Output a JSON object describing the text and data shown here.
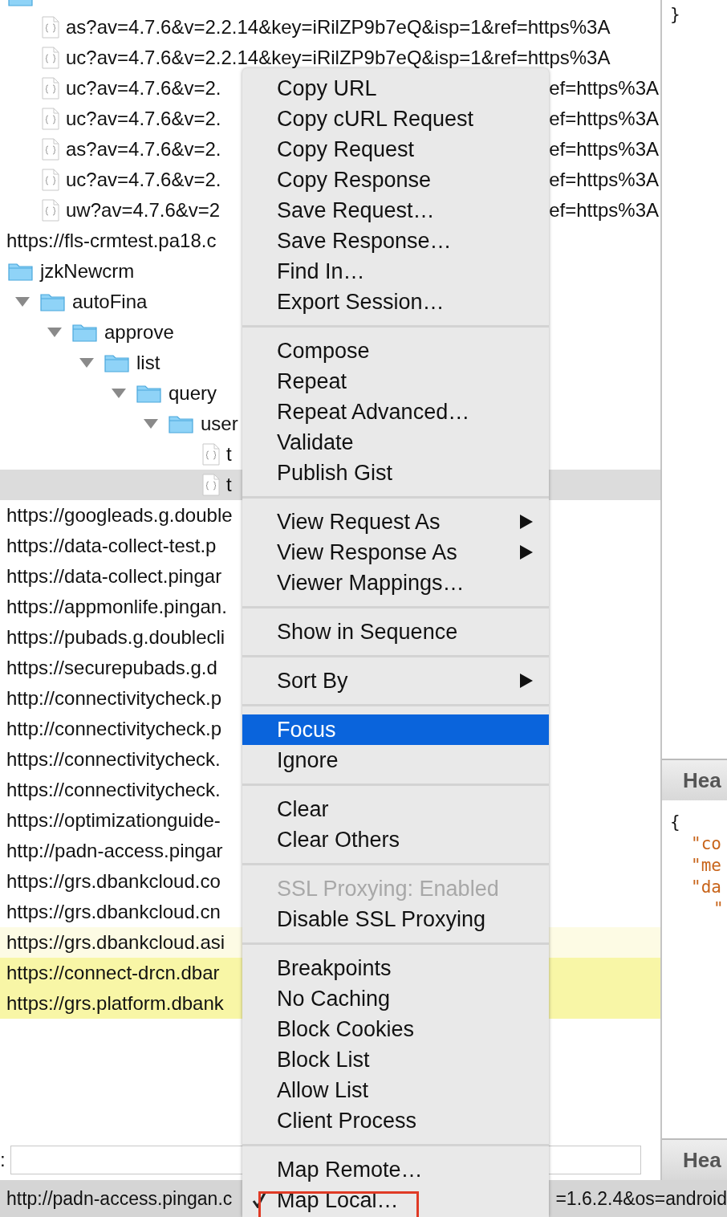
{
  "tree": [
    {
      "kind": "folder",
      "selected": false,
      "children": [
        {
          "kind": "file",
          "label": "as?av=4.7.6&v=2.2.14&key=iRilZP9b7eQ&isp=1&ref=https%3A",
          "selected": false
        },
        {
          "kind": "file",
          "label": "uc?av=4.7.6&v=2.2.14&key=iRilZP9b7eQ&isp=1&ref=https%3A",
          "selected": false
        },
        {
          "kind": "file",
          "label": "uc?av=4.7.6&v=2.",
          "tail": "ef=https%3A",
          "selected": false
        },
        {
          "kind": "file",
          "label": "uc?av=4.7.6&v=2.",
          "tail": "ef=https%3A",
          "selected": false
        },
        {
          "kind": "file",
          "label": "as?av=4.7.6&v=2.",
          "tail": "ef=https%3A",
          "selected": false
        },
        {
          "kind": "file",
          "label": "uc?av=4.7.6&v=2.",
          "tail": "ef=https%3A",
          "selected": false
        },
        {
          "kind": "file",
          "label": "uw?av=4.7.6&v=2",
          "tail": "ef=https%3A",
          "selected": false
        }
      ]
    },
    {
      "kind": "host",
      "label": "https://fls-crmtest.pa18.c",
      "selected": false
    },
    {
      "kind": "folder",
      "label": "jzkNewcrm",
      "selected": false,
      "children": [
        {
          "kind": "folder",
          "label": "autoFina",
          "expanded": true,
          "selected": false,
          "children": [
            {
              "kind": "folder",
              "label": "approve",
              "expanded": true,
              "selected": false,
              "children": [
                {
                  "kind": "folder",
                  "label": "list",
                  "expanded": true,
                  "selected": false,
                  "children": [
                    {
                      "kind": "folder",
                      "label": "query",
                      "expanded": true,
                      "selected": false,
                      "children": [
                        {
                          "kind": "folder",
                          "label": "user",
                          "expanded": true,
                          "selected": false,
                          "children": [
                            {
                              "kind": "file",
                              "label": "t",
                              "selected": false
                            },
                            {
                              "kind": "file",
                              "label": "t",
                              "selected": true
                            }
                          ]
                        }
                      ]
                    }
                  ]
                }
              ]
            }
          ]
        }
      ]
    },
    {
      "kind": "host",
      "label": "https://googleads.g.double",
      "selected": false
    },
    {
      "kind": "host",
      "label": "https://data-collect-test.p",
      "selected": false
    },
    {
      "kind": "host",
      "label": "https://data-collect.pingar",
      "selected": false
    },
    {
      "kind": "host",
      "label": "https://appmonlife.pingan.",
      "selected": false
    },
    {
      "kind": "host",
      "label": "https://pubads.g.doublecli",
      "selected": false
    },
    {
      "kind": "host",
      "label": "https://securepubads.g.d",
      "selected": false
    },
    {
      "kind": "host",
      "label": "http://connectivitycheck.p",
      "selected": false
    },
    {
      "kind": "host",
      "label": "http://connectivitycheck.p",
      "selected": false
    },
    {
      "kind": "host",
      "label": "https://connectivitycheck.",
      "selected": false
    },
    {
      "kind": "host",
      "label": "https://connectivitycheck.",
      "selected": false
    },
    {
      "kind": "host",
      "label": "https://optimizationguide-",
      "selected": false
    },
    {
      "kind": "host",
      "label": "http://padn-access.pingar",
      "selected": false
    },
    {
      "kind": "host",
      "label": "https://grs.dbankcloud.co",
      "selected": false
    },
    {
      "kind": "host",
      "label": "https://grs.dbankcloud.cn",
      "selected": false
    },
    {
      "kind": "host",
      "label": "https://grs.dbankcloud.asi",
      "selected": false,
      "color": "#fdfbe4"
    },
    {
      "kind": "host",
      "label": "https://connect-drcn.dbar",
      "selected": false,
      "color": "#f8f6a6"
    },
    {
      "kind": "host",
      "label": "https://grs.platform.dbank",
      "selected": false,
      "color": "#f8f6a6"
    }
  ],
  "filter": {
    "label": ":"
  },
  "right_pane": {
    "top_text": "}",
    "tabs": [
      "Hea",
      "Hea"
    ],
    "body_open": "{",
    "body_lines": [
      "\"co",
      "\"me",
      "\"da",
      "\""
    ]
  },
  "status_bar": {
    "left": "http://padn-access.pingan.c",
    "right": "=1.6.2.4&os=android"
  },
  "context_menu": {
    "groups": [
      [
        {
          "label": "Copy URL"
        },
        {
          "label": "Copy cURL Request"
        },
        {
          "label": "Copy Request"
        },
        {
          "label": "Copy Response"
        },
        {
          "label": "Save Request…"
        },
        {
          "label": "Save Response…"
        },
        {
          "label": "Find In…"
        },
        {
          "label": "Export Session…"
        }
      ],
      [
        {
          "label": "Compose"
        },
        {
          "label": "Repeat"
        },
        {
          "label": "Repeat Advanced…"
        },
        {
          "label": "Validate"
        },
        {
          "label": "Publish Gist"
        }
      ],
      [
        {
          "label": "View Request As",
          "submenu": true
        },
        {
          "label": "View Response As",
          "submenu": true
        },
        {
          "label": "Viewer Mappings…"
        }
      ],
      [
        {
          "label": "Show in Sequence"
        }
      ],
      [
        {
          "label": "Sort By",
          "submenu": true
        }
      ],
      [
        {
          "label": "Focus",
          "selected": true
        },
        {
          "label": "Ignore"
        }
      ],
      [
        {
          "label": "Clear"
        },
        {
          "label": "Clear Others"
        }
      ],
      [
        {
          "label": "SSL Proxying: Enabled",
          "disabled": true
        },
        {
          "label": "Disable SSL Proxying"
        }
      ],
      [
        {
          "label": "Breakpoints"
        },
        {
          "label": "No Caching"
        },
        {
          "label": "Block Cookies"
        },
        {
          "label": "Block List"
        },
        {
          "label": "Allow List"
        },
        {
          "label": "Client Process"
        }
      ],
      [
        {
          "label": "Map Remote…"
        },
        {
          "label": "Map Local…",
          "checked": true,
          "annotated": true
        }
      ]
    ]
  }
}
